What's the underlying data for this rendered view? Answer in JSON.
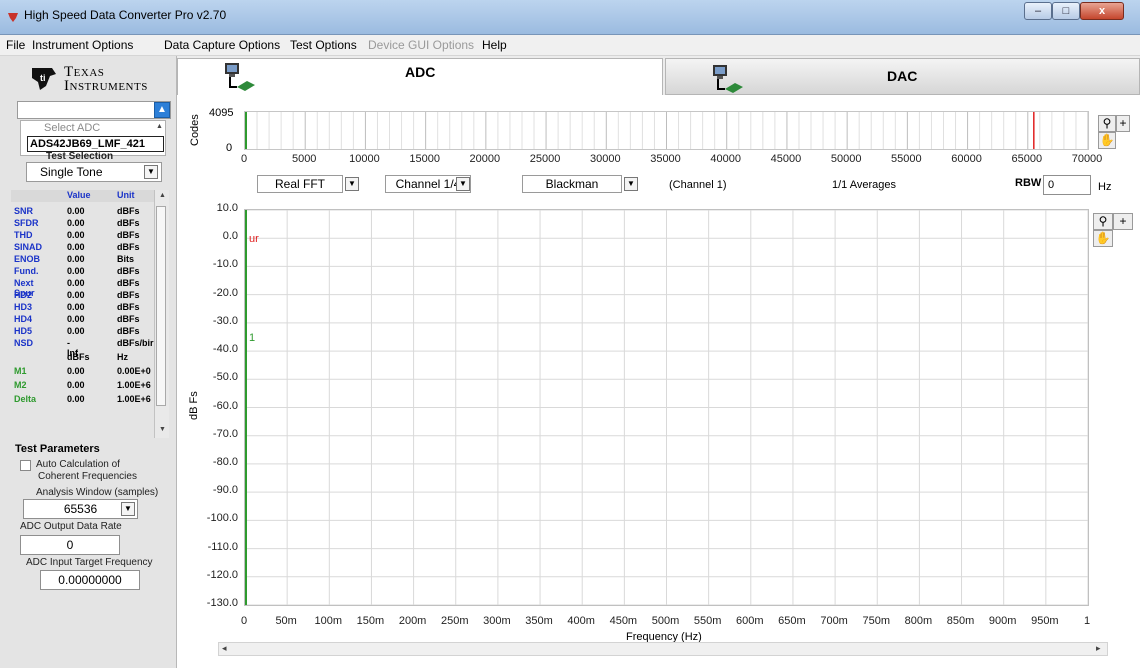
{
  "window": {
    "title": "High Speed Data Converter Pro v2.70",
    "minimize": "–",
    "maximize": "□",
    "close": "x"
  },
  "menu": [
    "File",
    "Instrument Options",
    "Data Capture Options",
    "Test Options",
    "Device GUI Options",
    "Help"
  ],
  "menu_disabled": [
    "Device GUI Options"
  ],
  "logo": {
    "line1": "Texas",
    "line2": "Instruments"
  },
  "adc_select": {
    "placeholder": "Select ADC",
    "value": "ADS42JB69_LMF_421"
  },
  "test_selection": {
    "label": "Test Selection",
    "value": "Single Tone"
  },
  "metrics_table": {
    "headers": [
      "",
      "Value",
      "Unit"
    ],
    "rows": [
      {
        "name": "SNR",
        "value": "0.00",
        "unit": "dBFs"
      },
      {
        "name": "SFDR",
        "value": "0.00",
        "unit": "dBFs"
      },
      {
        "name": "THD",
        "value": "0.00",
        "unit": "dBFs"
      },
      {
        "name": "SINAD",
        "value": "0.00",
        "unit": "dBFs"
      },
      {
        "name": "ENOB",
        "value": "0.00",
        "unit": "Bits"
      },
      {
        "name": "Fund.",
        "value": "0.00",
        "unit": "dBFs"
      },
      {
        "name": "Next Spur",
        "value": "0.00",
        "unit": "dBFs"
      },
      {
        "name": "HD2",
        "value": "0.00",
        "unit": "dBFs"
      },
      {
        "name": "HD3",
        "value": "0.00",
        "unit": "dBFs"
      },
      {
        "name": "HD4",
        "value": "0.00",
        "unit": "dBFs"
      },
      {
        "name": "HD5",
        "value": "0.00",
        "unit": "dBFs"
      },
      {
        "name": "NSD",
        "value": "-Inf",
        "unit": "dBFs/bir"
      }
    ],
    "marker_header": {
      "value": "dBFs",
      "unit": "Hz"
    },
    "marker_rows": [
      {
        "name": "M1",
        "value": "0.00",
        "unit": "0.00E+0"
      },
      {
        "name": "M2",
        "value": "0.00",
        "unit": "1.00E+6"
      },
      {
        "name": "Delta",
        "value": "0.00",
        "unit": "1.00E+6"
      }
    ],
    "colors": {
      "name_blue": "#1a33c8",
      "marker_green": "#2e9a2e"
    }
  },
  "test_parameters": {
    "title": "Test Parameters",
    "auto_calc_line1": "Auto Calculation of",
    "auto_calc_line2": "Coherent Frequencies",
    "analysis_window_label": "Analysis Window (samples)",
    "analysis_window_value": "65536",
    "output_rate_label": "ADC Output Data Rate",
    "output_rate_value": "0",
    "target_freq_label": "ADC Input Target Frequency",
    "target_freq_value": "0.00000000"
  },
  "tabs": {
    "adc": "ADC",
    "dac": "DAC"
  },
  "codes_plot": {
    "ylabel": "Codes",
    "ytick_top": "4095",
    "ytick_bottom": "0",
    "xticks": [
      "0",
      "5000",
      "10000",
      "15000",
      "20000",
      "25000",
      "30000",
      "35000",
      "40000",
      "45000",
      "50000",
      "55000",
      "60000",
      "65000",
      "70000"
    ],
    "marker_color": "#e02020"
  },
  "controls": {
    "fft_mode": "Real FFT",
    "channel": "Channel 1/4",
    "window": "Blackman",
    "channel_label": "(Channel 1)",
    "averages": "1/1 Averages",
    "rbw_label": "RBW",
    "rbw_value": "0",
    "rbw_unit": "Hz"
  },
  "chart_data": {
    "type": "line",
    "xlabel": "Frequency (Hz)",
    "ylabel": "dB Fs",
    "ylim": [
      -130,
      10
    ],
    "yticks": [
      "10.0",
      "0.0",
      "-10.0",
      "-20.0",
      "-30.0",
      "-40.0",
      "-50.0",
      "-60.0",
      "-70.0",
      "-80.0",
      "-90.0",
      "-100.0",
      "-110.0",
      "-120.0",
      "-130.0"
    ],
    "xticks": [
      "0",
      "50m",
      "100m",
      "150m",
      "200m",
      "250m",
      "300m",
      "350m",
      "400m",
      "450m",
      "500m",
      "550m",
      "600m",
      "650m",
      "700m",
      "750m",
      "800m",
      "850m",
      "900m",
      "950m",
      "1"
    ],
    "grid": true,
    "series": [],
    "marker_labels": [
      {
        "text": "ur",
        "y": 0,
        "color": "#e02020"
      },
      {
        "text": "1",
        "y": -35,
        "color": "#2e9a2e"
      }
    ]
  }
}
